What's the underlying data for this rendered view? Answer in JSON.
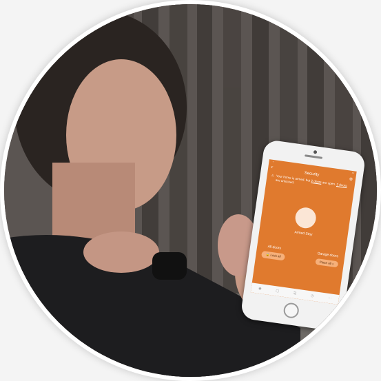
{
  "phone_screen": {
    "app_title": "Security",
    "alert_text_before": "Your home is armed, but",
    "alert_link_doors": "2 doors",
    "alert_text_middle": "are open.",
    "alert_link_unlocked": "2 doors",
    "alert_text_after": "are unlocked.",
    "mode_label": "Armed Stay",
    "all_doors_label": "All doors",
    "lock_all_button": "Lock all",
    "garage_doors_label": "Garage doors",
    "close_all_button": "Close all",
    "accent_color": "#e07a2e"
  }
}
